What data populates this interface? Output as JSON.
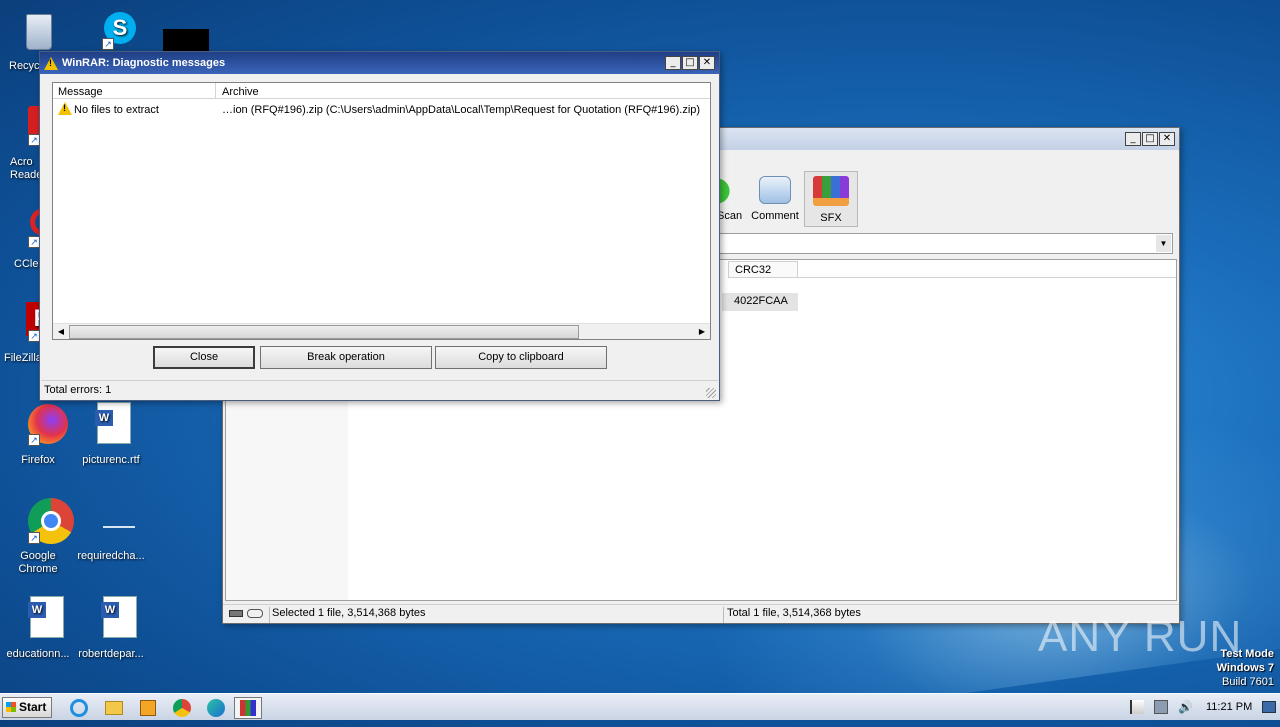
{
  "desktop": {
    "icons": [
      {
        "label": "Recyc"
      },
      {
        "label": ""
      },
      {
        "label": ""
      },
      {
        "label": "Acro\nReade"
      },
      {
        "label": "CClea"
      },
      {
        "label": "FileZilla"
      },
      {
        "label": "Firefox"
      },
      {
        "label": "picturenc.rtf"
      },
      {
        "label": "Google\nChrome"
      },
      {
        "label": "requiredcha..."
      },
      {
        "label": "educationn..."
      },
      {
        "label": "robertdepar..."
      }
    ]
  },
  "winrar_main": {
    "toolbar": {
      "scan_label": "Scan",
      "comment_label": "Comment",
      "sfx_label": "SFX"
    },
    "columns": {
      "crc_label": "CRC32"
    },
    "row": {
      "crc": "4022FCAA"
    },
    "status": {
      "selected": "Selected 1 file, 3,514,368 bytes",
      "total": "Total 1 file, 3,514,368 bytes"
    }
  },
  "diag": {
    "title": "WinRAR: Diagnostic messages",
    "columns": {
      "message": "Message",
      "archive": "Archive"
    },
    "rows": [
      {
        "message": "No files to extract",
        "archive": "…ion (RFQ#196).zip (C:\\Users\\admin\\AppData\\Local\\Temp\\Request for Quotation (RFQ#196).zip)"
      }
    ],
    "buttons": {
      "close": "Close",
      "break": "Break operation",
      "copy": "Copy to clipboard"
    },
    "status": "Total errors: 1"
  },
  "watermark": {
    "brand": "ANY RUN",
    "mode": "Test Mode",
    "os": "Windows 7",
    "build": "Build 7601"
  },
  "taskbar": {
    "start_label": "Start",
    "clock": "11:21 PM"
  },
  "colors": {
    "title_active": "#2b4f9f",
    "desktop": "#1a6dbb"
  }
}
